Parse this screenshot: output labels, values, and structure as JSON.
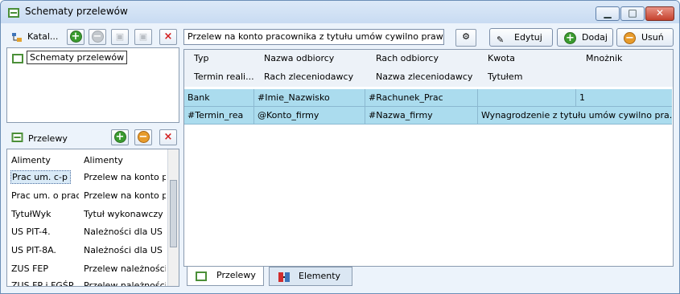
{
  "window": {
    "title": "Schematy przelewów",
    "controls": {
      "minimize": "▁",
      "maximize": "□",
      "close": "✕"
    }
  },
  "catalog": {
    "label": "Katal...",
    "tree_root": "Schematy przelewów"
  },
  "toolbar": {
    "description": "Przelew na konto pracownika z tytułu umów cywilno praw...",
    "edit": "Edytuj",
    "add": "Dodaj",
    "delete": "Usuń"
  },
  "headers": {
    "row1": [
      "Typ",
      "Nazwa odbiorcy",
      "Rach odbiorcy",
      "Kwota",
      "Mnożnik"
    ],
    "row2": [
      "Termin reali...",
      "Rach zleceniodawcy",
      "Nazwa zleceniodawcy",
      "Tytułem"
    ]
  },
  "rows": [
    [
      "Bank",
      "#Imie_Nazwisko",
      "#Rachunek_Prac",
      "",
      "1"
    ],
    [
      "#Termin_rea",
      "@Konto_firmy",
      "#Nazwa_firmy",
      "Wynagrodzenie z tytułu umów cywilno pra..."
    ]
  ],
  "przelewy": {
    "title": "Przelewy",
    "items": [
      [
        "Alimenty",
        "Alimenty"
      ],
      [
        "Prac um. c-p",
        "Przelew na konto pr"
      ],
      [
        "Prac um. o prac",
        "Przelew na konto pr"
      ],
      [
        "TytułWyk",
        "Tytuł wykonawczy"
      ],
      [
        "US PIT-4.",
        "Należności dla US o"
      ],
      [
        "US PIT-8A.",
        "Należności dla US o"
      ],
      [
        "ZUS FEP",
        "Przelew należności"
      ],
      [
        "ZUS FP i FGŚP",
        "Przelew należności"
      ]
    ]
  },
  "tabs": [
    "Przelewy",
    "Elementy"
  ],
  "colors": {
    "selected_row": "#abdcee",
    "accent": "#3a9b2f",
    "danger": "#d31d1d"
  }
}
